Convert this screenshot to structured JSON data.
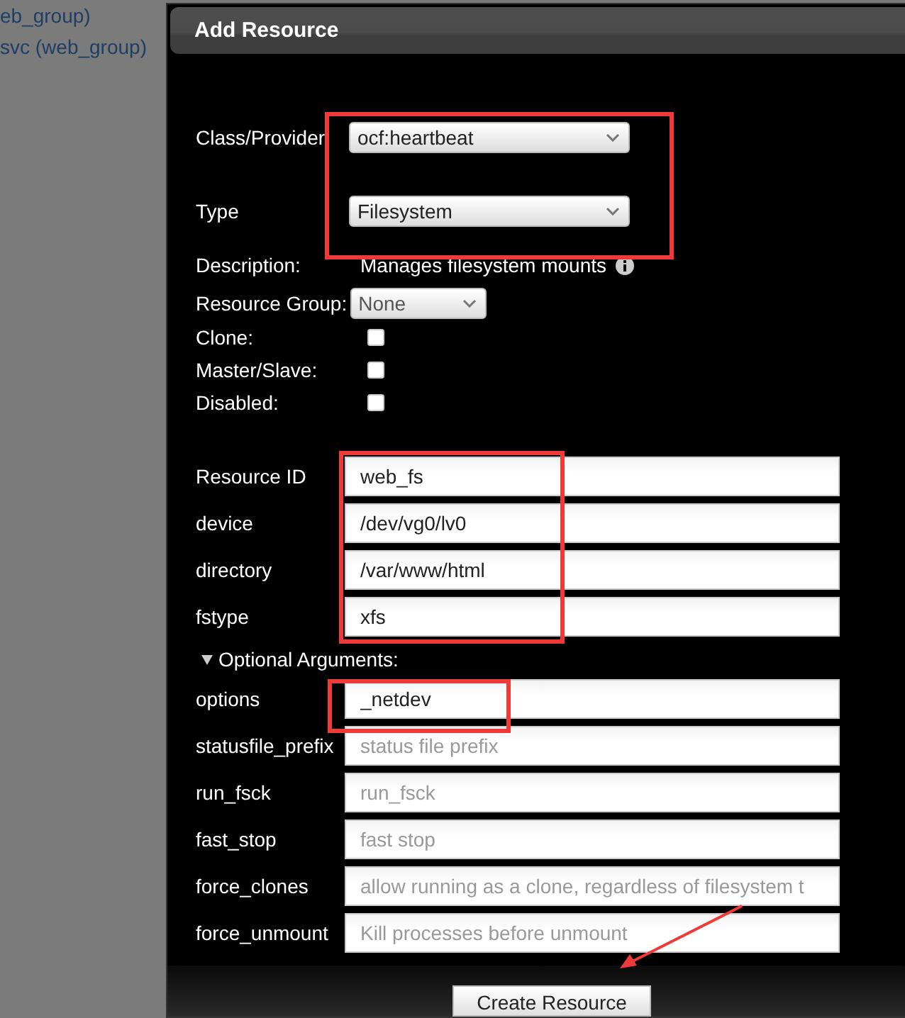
{
  "sidebar": {
    "items": [
      "eb_group)",
      "svc (web_group)"
    ]
  },
  "dialog": {
    "title": "Add Resource",
    "selects": [
      {
        "label": "Class/Provider",
        "value": "ocf:heartbeat"
      },
      {
        "label": "Type",
        "value": "Filesystem"
      }
    ],
    "description": {
      "label": "Description:",
      "text": "Manages filesystem mounts"
    },
    "resource_group": {
      "label": "Resource Group:",
      "value": "None"
    },
    "checkboxes": [
      {
        "label": "Clone:",
        "checked": false
      },
      {
        "label": "Master/Slave:",
        "checked": false
      },
      {
        "label": "Disabled:",
        "checked": false
      }
    ],
    "required_fields": [
      {
        "label": "Resource ID",
        "value": "web_fs"
      },
      {
        "label": "device",
        "value": "/dev/vg0/lv0"
      },
      {
        "label": "directory",
        "value": "/var/www/html"
      },
      {
        "label": "fstype",
        "value": "xfs"
      }
    ],
    "optional_section": {
      "label": "Optional Arguments:",
      "expanded": true
    },
    "optional_fields": [
      {
        "label": "options",
        "value": "_netdev"
      },
      {
        "label": "statusfile_prefix",
        "placeholder": "status file prefix"
      },
      {
        "label": "run_fsck",
        "placeholder": "run_fsck"
      },
      {
        "label": "fast_stop",
        "placeholder": "fast stop"
      },
      {
        "label": "force_clones",
        "placeholder": "allow running as a clone, regardless of filesystem t"
      },
      {
        "label": "force_unmount",
        "placeholder": "Kill processes before unmount"
      }
    ],
    "create_button": "Create Resource"
  }
}
